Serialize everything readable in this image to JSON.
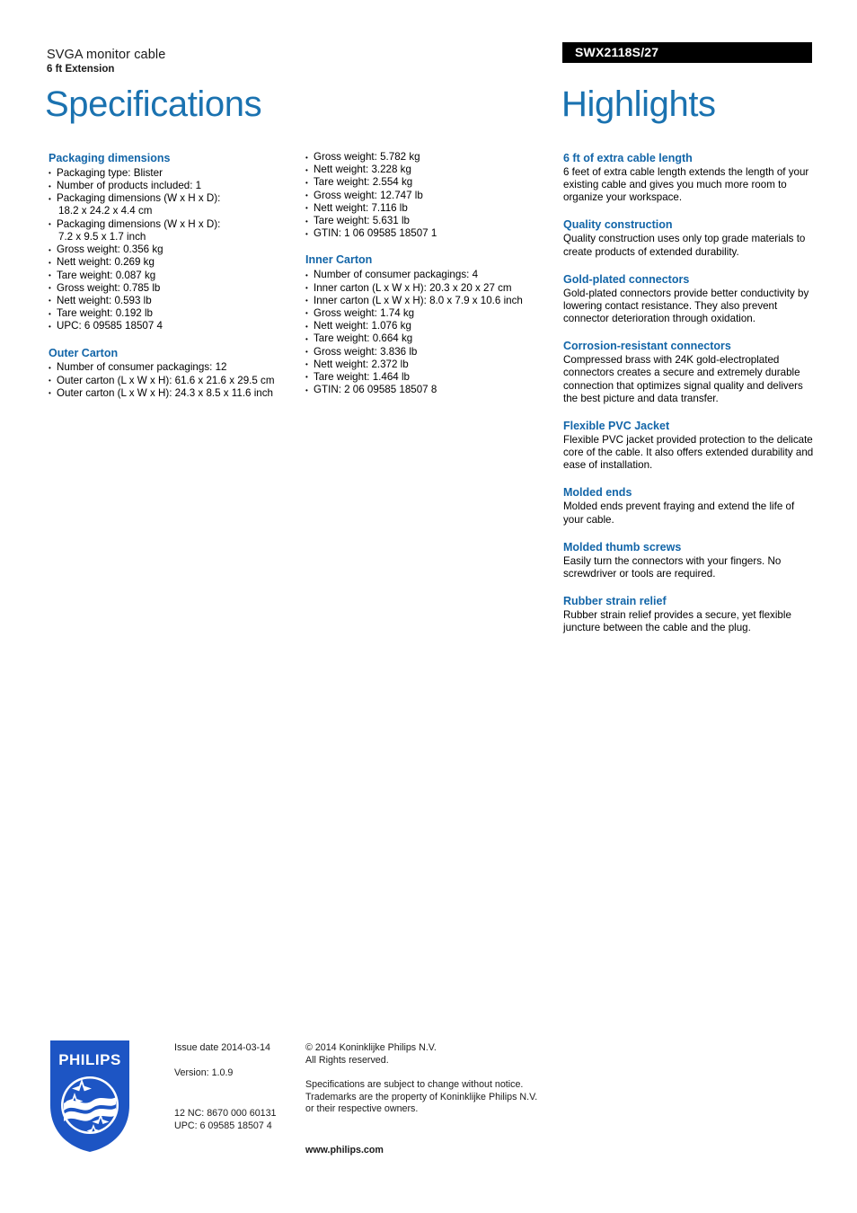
{
  "header": {
    "product_title": "SVGA monitor cable",
    "product_subtitle": "6 ft Extension",
    "model_number": "SWX2118S/27",
    "left_heading": "Specifications",
    "right_heading": "Highlights"
  },
  "specifications": {
    "column1": [
      {
        "title": "Packaging dimensions",
        "items": [
          {
            "text": "Packaging type: Blister"
          },
          {
            "text": "Number of products included: 1"
          },
          {
            "text": "Packaging dimensions (W x H x D):",
            "cont": "18.2 x 24.2 x 4.4 cm"
          },
          {
            "text": "Packaging dimensions (W x H x D):",
            "cont": "7.2 x 9.5 x 1.7 inch"
          },
          {
            "text": "Gross weight: 0.356 kg"
          },
          {
            "text": "Nett weight: 0.269 kg"
          },
          {
            "text": "Tare weight: 0.087 kg"
          },
          {
            "text": "Gross weight: 0.785 lb"
          },
          {
            "text": "Nett weight: 0.593 lb"
          },
          {
            "text": "Tare weight: 0.192 lb"
          },
          {
            "text": "UPC: 6 09585 18507 4"
          }
        ]
      },
      {
        "title": "Outer Carton",
        "items": [
          {
            "text": "Number of consumer packagings: 12"
          },
          {
            "text": "Outer carton (L x W x H): 61.6 x 21.6 x 29.5 cm"
          },
          {
            "text": "Outer carton (L x W x H): 24.3 x 8.5 x 11.6 inch"
          }
        ]
      }
    ],
    "column2": [
      {
        "title": "",
        "items": [
          {
            "text": "Gross weight: 5.782 kg"
          },
          {
            "text": "Nett weight: 3.228 kg"
          },
          {
            "text": "Tare weight: 2.554 kg"
          },
          {
            "text": "Gross weight: 12.747 lb"
          },
          {
            "text": "Nett weight: 7.116 lb"
          },
          {
            "text": "Tare weight: 5.631 lb"
          },
          {
            "text": "GTIN: 1 06 09585 18507 1"
          }
        ]
      },
      {
        "title": "Inner Carton",
        "items": [
          {
            "text": "Number of consumer packagings: 4"
          },
          {
            "text": "Inner carton (L x W x H): 20.3 x 20 x 27 cm"
          },
          {
            "text": "Inner carton (L x W x H): 8.0 x 7.9 x 10.6 inch"
          },
          {
            "text": "Gross weight: 1.74 kg"
          },
          {
            "text": "Nett weight: 1.076 kg"
          },
          {
            "text": "Tare weight: 0.664 kg"
          },
          {
            "text": "Gross weight: 3.836 lb"
          },
          {
            "text": "Nett weight: 2.372 lb"
          },
          {
            "text": "Tare weight: 1.464 lb"
          },
          {
            "text": "GTIN: 2 06 09585 18507 8"
          }
        ]
      }
    ]
  },
  "highlights": [
    {
      "title": "6 ft of extra cable length",
      "body": "6 feet of extra cable length extends the length of your existing cable and gives you much more room to organize your workspace."
    },
    {
      "title": "Quality construction",
      "body": "Quality construction uses only top grade materials to create products of extended durability."
    },
    {
      "title": "Gold-plated connectors",
      "body": "Gold-plated connectors provide better conductivity by lowering contact resistance. They also prevent connector deterioration through oxidation."
    },
    {
      "title": "Corrosion-resistant connectors",
      "body": "Compressed brass with 24K gold-electroplated connectors creates a secure and extremely durable connection that optimizes signal quality and delivers the best picture and data transfer."
    },
    {
      "title": "Flexible PVC Jacket",
      "body": "Flexible PVC jacket provided protection to the delicate core of the cable. It also offers extended durability and ease of installation."
    },
    {
      "title": "Molded ends",
      "body": "Molded ends prevent fraying and extend the life of your cable."
    },
    {
      "title": "Molded thumb screws",
      "body": "Easily turn the connectors with your fingers. No screwdriver or tools are required."
    },
    {
      "title": "Rubber strain relief",
      "body": "Rubber strain relief provides a secure, yet flexible juncture between the cable and the plug."
    }
  ],
  "footer": {
    "logo_wordmark": "PHILIPS",
    "issue_date": "Issue date 2014-03-14",
    "version": "Version: 1.0.9",
    "nc_code": "12 NC: 8670 000 60131",
    "upc": "UPC: 6 09585 18507 4",
    "copyright_line1": "© 2014 Koninklijke Philips N.V.",
    "copyright_line2": "All Rights reserved.",
    "disclaimer_line1": "Specifications are subject to change without notice.",
    "disclaimer_line2": "Trademarks are the property of Koninklijke Philips N.V.",
    "disclaimer_line3": "or their respective owners.",
    "website": "www.philips.com"
  },
  "colors": {
    "heading_blue": "#1a72b0",
    "section_blue": "#1265a8",
    "logo_blue": "#1d55c4",
    "model_bar_bg": "#000000"
  }
}
